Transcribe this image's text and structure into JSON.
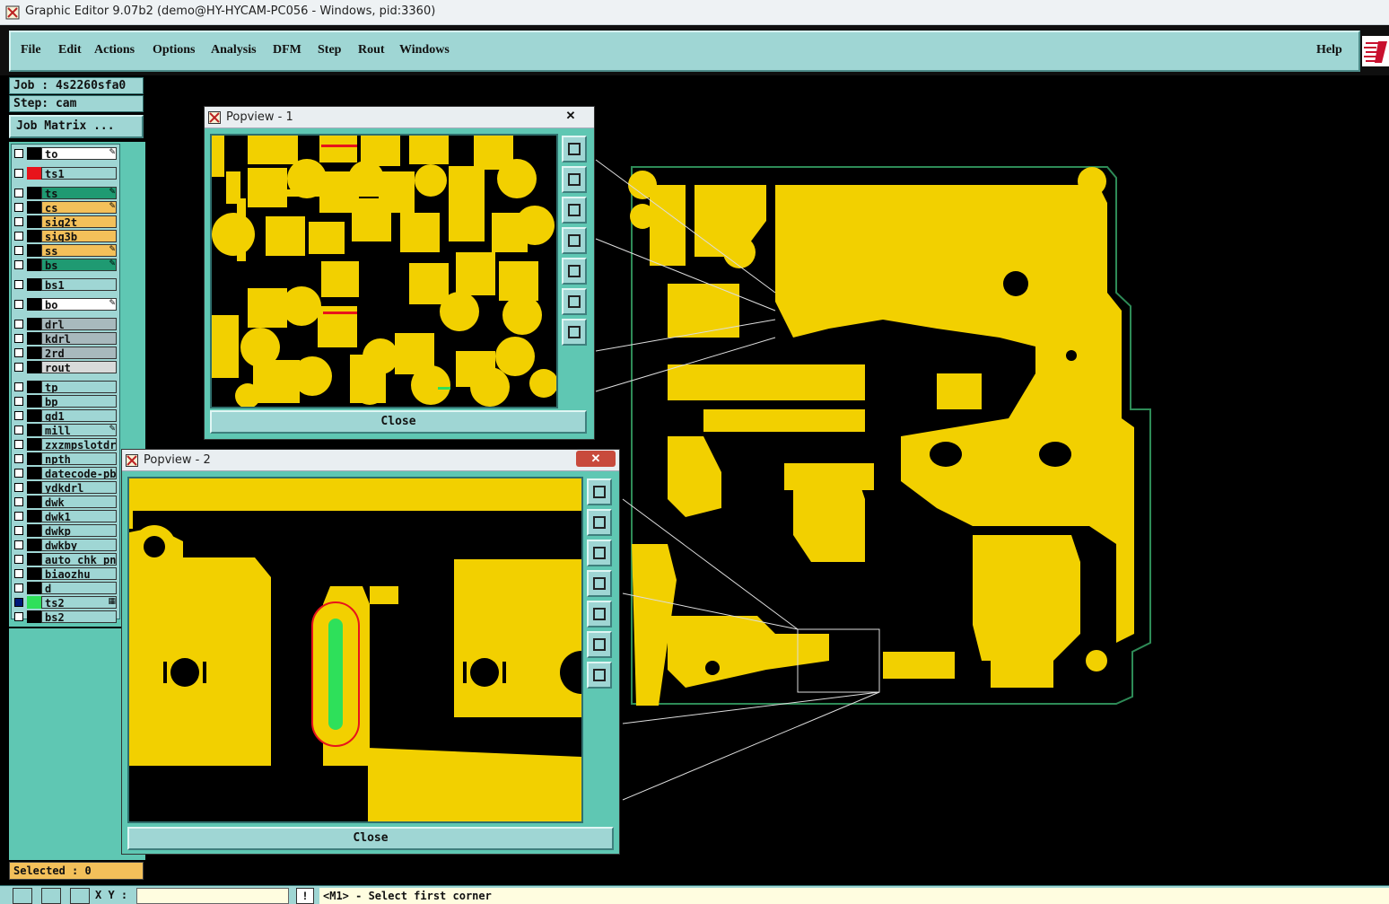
{
  "window": {
    "title": "Graphic Editor 9.07b2 (demo@HY-HYCAM-PC056 - Windows, pid:3360)"
  },
  "menu": {
    "items": [
      "File",
      "Edit",
      "Actions",
      "Options",
      "Analysis",
      "DFM",
      "Step",
      "Rout",
      "Windows"
    ],
    "help": "Help"
  },
  "job": {
    "job": "Job : 4s2260sfa0",
    "step": "Step: cam",
    "matrix": "Job Matrix ..."
  },
  "layers": [
    {
      "name": "to",
      "color": "#ffffff",
      "swatch": "#000000",
      "flag": "✎"
    },
    {
      "name": "ts1",
      "color": "#9fd6d4",
      "swatch": "#e8141b",
      "flag": ""
    },
    {
      "name": "ts",
      "color": "#1f9a72",
      "swatch": "#000000",
      "flag": "✎"
    },
    {
      "name": "cs",
      "color": "#f3c05a",
      "swatch": "#000000",
      "flag": "✎"
    },
    {
      "name": "sig2t",
      "color": "#f3c05a",
      "swatch": "#000000",
      "flag": ""
    },
    {
      "name": "sig3b",
      "color": "#f3c05a",
      "swatch": "#000000",
      "flag": ""
    },
    {
      "name": "ss",
      "color": "#f3c05a",
      "swatch": "#000000",
      "flag": "✎"
    },
    {
      "name": "bs",
      "color": "#1f9a72",
      "swatch": "#000000",
      "flag": "✎"
    },
    {
      "name": "bs1",
      "color": "#9fd6d4",
      "swatch": "#000000",
      "flag": ""
    },
    {
      "name": "bo",
      "color": "#ffffff",
      "swatch": "#000000",
      "flag": "✎"
    },
    {
      "name": "drl",
      "color": "#a8b9bd",
      "swatch": "#000000",
      "flag": ""
    },
    {
      "name": "kdrl",
      "color": "#a8b9bd",
      "swatch": "#000000",
      "flag": ""
    },
    {
      "name": "2rd",
      "color": "#a8b9bd",
      "swatch": "#000000",
      "flag": ""
    },
    {
      "name": "rout",
      "color": "#d8dada",
      "swatch": "#000000",
      "flag": ""
    },
    {
      "name": "tp",
      "color": "#9fd6d4",
      "swatch": "#000000",
      "flag": ""
    },
    {
      "name": "bp",
      "color": "#9fd6d4",
      "swatch": "#000000",
      "flag": ""
    },
    {
      "name": "gd1",
      "color": "#9fd6d4",
      "swatch": "#000000",
      "flag": ""
    },
    {
      "name": "mill",
      "color": "#9fd6d4",
      "swatch": "#000000",
      "flag": "✎"
    },
    {
      "name": "zxzmpslotdrl",
      "color": "#9fd6d4",
      "swatch": "#000000",
      "flag": ""
    },
    {
      "name": "npth",
      "color": "#9fd6d4",
      "swatch": "#000000",
      "flag": ""
    },
    {
      "name": "datecode-pbo",
      "color": "#9fd6d4",
      "swatch": "#000000",
      "flag": ""
    },
    {
      "name": "ydkdrl",
      "color": "#9fd6d4",
      "swatch": "#000000",
      "flag": ""
    },
    {
      "name": "dwk",
      "color": "#9fd6d4",
      "swatch": "#000000",
      "flag": ""
    },
    {
      "name": "dwk1",
      "color": "#9fd6d4",
      "swatch": "#000000",
      "flag": ""
    },
    {
      "name": "dwkp",
      "color": "#9fd6d4",
      "swatch": "#000000",
      "flag": ""
    },
    {
      "name": "dwkby",
      "color": "#9fd6d4",
      "swatch": "#000000",
      "flag": ""
    },
    {
      "name": "auto_chk_pnl",
      "color": "#9fd6d4",
      "swatch": "#000000",
      "flag": ""
    },
    {
      "name": "biaozhu",
      "color": "#9fd6d4",
      "swatch": "#000000",
      "flag": ""
    },
    {
      "name": "d",
      "color": "#9fd6d4",
      "swatch": "#000000",
      "flag": ""
    },
    {
      "name": "ts2",
      "color": "#9fd6d4",
      "swatch": "#2ee05a",
      "flag": "▦"
    },
    {
      "name": "bs2",
      "color": "#9fd6d4",
      "swatch": "#000000",
      "flag": ""
    }
  ],
  "selected": "Selected : 0",
  "status": {
    "xy_label": "X Y :",
    "prompt": "<M1> - Select first corner",
    "excl": "!"
  },
  "popview1": {
    "title": "Popview - 1",
    "close": "Close"
  },
  "popview2": {
    "title": "Popview - 2",
    "close": "Close"
  },
  "colors": {
    "copper": "#f2d000",
    "panel": "#9fd6d4",
    "panel_dark": "#5fc7b3",
    "outline": "#2e8b57"
  }
}
